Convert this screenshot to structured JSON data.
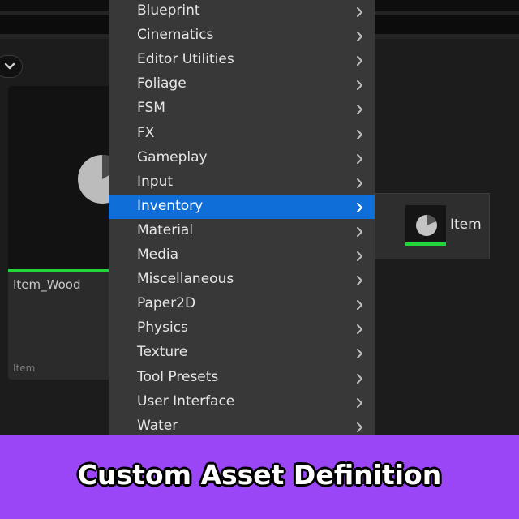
{
  "menu": {
    "items": [
      {
        "label": "Blueprint"
      },
      {
        "label": "Cinematics"
      },
      {
        "label": "Editor Utilities"
      },
      {
        "label": "Foliage"
      },
      {
        "label": "FSM"
      },
      {
        "label": "FX"
      },
      {
        "label": "Gameplay"
      },
      {
        "label": "Input"
      },
      {
        "label": "Inventory",
        "active": true
      },
      {
        "label": "Material"
      },
      {
        "label": "Media"
      },
      {
        "label": "Miscellaneous"
      },
      {
        "label": "Paper2D"
      },
      {
        "label": "Physics"
      },
      {
        "label": "Texture"
      },
      {
        "label": "Tool Presets"
      },
      {
        "label": "User Interface"
      },
      {
        "label": "Water"
      }
    ],
    "highlight_color": "#0f6ed8"
  },
  "submenu": {
    "items": [
      {
        "label": "Item",
        "icon": "pie-chart-icon"
      }
    ]
  },
  "asset": {
    "name": "Item_Wood",
    "type": "Item",
    "icon": "pie-chart-icon",
    "accent_color": "#22d63a"
  },
  "banner": {
    "text": "Custom Asset Definition",
    "color": "#9a45f6"
  }
}
